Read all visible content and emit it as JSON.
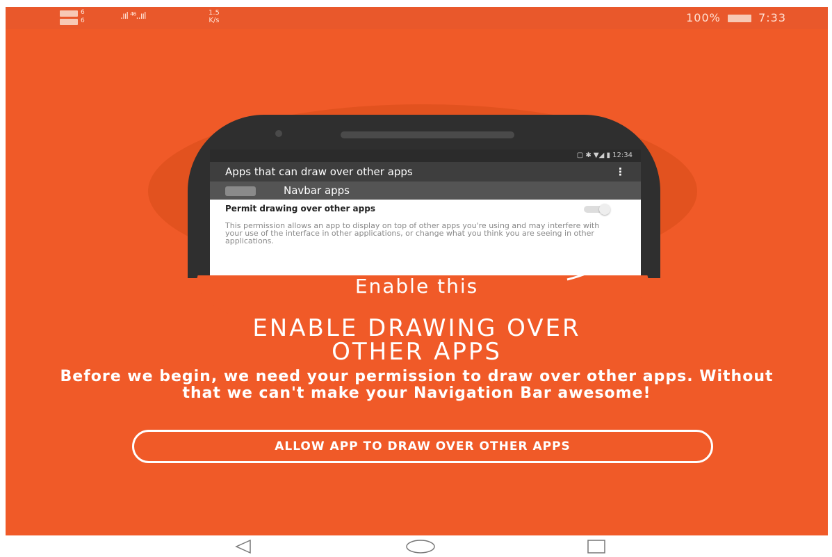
{
  "status_bar": {
    "sim1": "6",
    "sim2": "6",
    "signal": ".ııl ⁴⁶..ııl",
    "speed_value": "1.5",
    "speed_unit": "K/s",
    "battery": "100%",
    "time": "7:33"
  },
  "illustration": {
    "status_time": "12:34",
    "appbar_title": "Apps that can draw over other apps",
    "appbar_menu": "⋮",
    "app_name": "Navbar apps",
    "permission_title": "Permit drawing over other apps",
    "permission_desc": "This permission allows an app to display on top of other apps you're using and may interfere with your use of the interface in other applications, or change what you think you are seeing in other applications."
  },
  "hint": "Enable this",
  "headline_line1": "ENABLE DRAWING OVER",
  "headline_line2": "OTHER APPS",
  "description": "Before we begin, we need your permission to draw over other apps. Without that we can't make your Navigation Bar awesome!",
  "allow_button": "ALLOW APP TO DRAW OVER OTHER APPS",
  "colors": {
    "accent": "#f05a28",
    "statusbar": "#e9582b"
  },
  "nav_icons": [
    "back-icon",
    "home-icon",
    "recents-icon"
  ]
}
